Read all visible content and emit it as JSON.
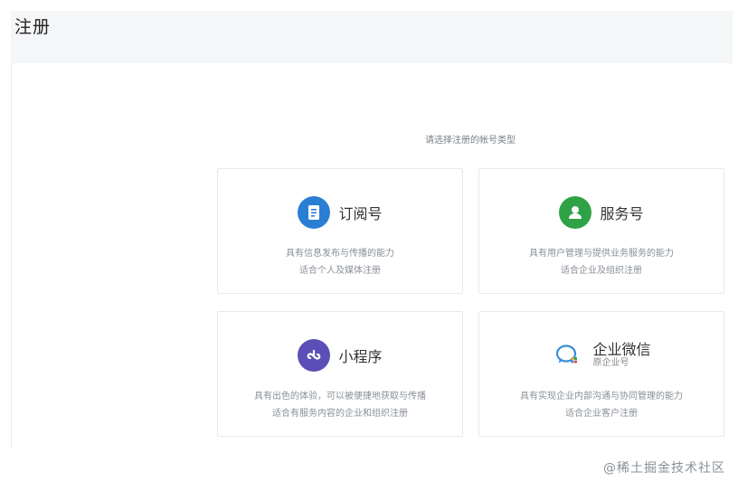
{
  "header": {
    "title": "注册"
  },
  "main": {
    "prompt": "请选择注册的帐号类型",
    "cards": [
      {
        "name": "订阅号",
        "icon": "document-icon",
        "color": "#2a7fd4",
        "desc": [
          "具有信息发布与传播的能力",
          "适合个人及媒体注册"
        ]
      },
      {
        "name": "服务号",
        "icon": "user-icon",
        "color": "#2ea245",
        "desc": [
          "具有用户管理与提供业务服务的能力",
          "适合企业及组织注册"
        ]
      },
      {
        "name": "小程序",
        "icon": "mini-program-icon",
        "color": "#5b4fb7",
        "desc": [
          "具有出色的体验，可以被便捷地获取与传播",
          "适合有服务内容的企业和组织注册"
        ]
      },
      {
        "name": "企业微信",
        "sub": "原企业号",
        "icon": "chat-bubble-icon",
        "color": "#3b8fd6",
        "desc": [
          "具有实现企业内部沟通与协同管理的能力",
          "适合企业客户注册"
        ]
      }
    ]
  },
  "watermark": "@稀土掘金技术社区"
}
